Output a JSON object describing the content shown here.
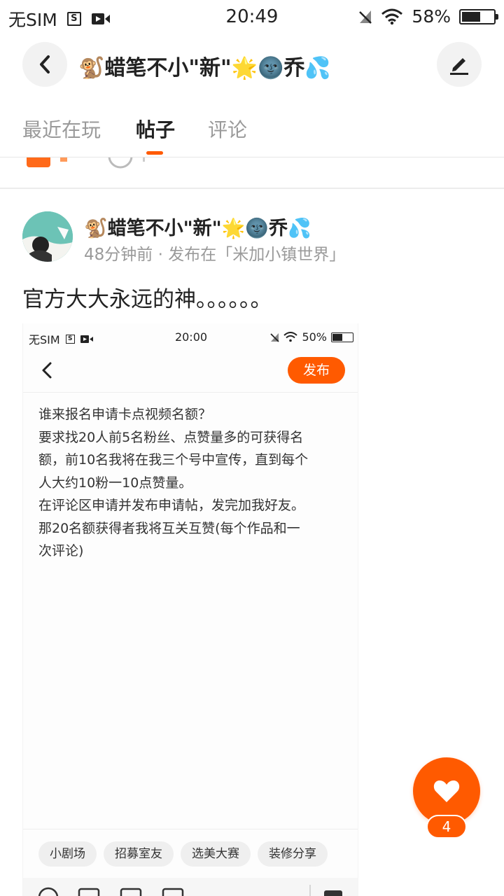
{
  "status_bar": {
    "carrier": "无SIM",
    "sim_icon_letter": "S",
    "time": "20:49",
    "battery": "58%",
    "battery_level": 0.58
  },
  "header": {
    "title": "🐒蜡笔不小\"新\"🌟🌚乔💦"
  },
  "tabs": [
    {
      "label": "最近在玩",
      "active": false
    },
    {
      "label": "帖子",
      "active": true
    },
    {
      "label": "评论",
      "active": false
    }
  ],
  "post": {
    "author": "🐒蜡笔不小\"新\"🌟🌚乔💦",
    "meta": "48分钟前 · 发布在「米加小镇世界」",
    "text": "官方大大永远的神。。。。。。"
  },
  "embedded_screenshot": {
    "status": {
      "carrier": "无SIM",
      "sim_icon_letter": "S",
      "time": "20:00",
      "battery": "50%",
      "battery_level": 0.5
    },
    "publish_label": "发布",
    "body_lines": [
      "谁来报名申请卡点视频名额？",
      "要求找20人前5名粉丝、点赞量多的可获得名",
      "额，前10名我将在我三个号中宣传，直到每个",
      "人大约10粉一10点赞量。",
      "在评论区申请并发布申请帖，发完加我好友。",
      "那20名额获得者我将互关互赞(每个作品和一",
      "次评论)"
    ],
    "chips": [
      "小剧场",
      "招募室友",
      "选美大赛",
      "装修分享"
    ]
  },
  "like": {
    "count": "4"
  },
  "colors": {
    "accent": "#ff5a00",
    "muted_text": "#9a9a9a"
  }
}
